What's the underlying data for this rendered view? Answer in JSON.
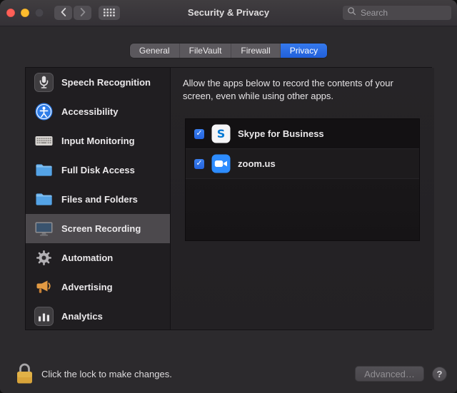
{
  "window": {
    "title": "Security & Privacy"
  },
  "toolbar": {
    "search_placeholder": "Search"
  },
  "tabs": {
    "items": [
      {
        "label": "General",
        "active": false
      },
      {
        "label": "FileVault",
        "active": false
      },
      {
        "label": "Firewall",
        "active": false
      },
      {
        "label": "Privacy",
        "active": true
      }
    ]
  },
  "sidebar": {
    "items": [
      {
        "label": "Speech Recognition",
        "icon": "microphone-icon",
        "selected": false
      },
      {
        "label": "Accessibility",
        "icon": "accessibility-icon",
        "selected": false
      },
      {
        "label": "Input Monitoring",
        "icon": "keyboard-icon",
        "selected": false
      },
      {
        "label": "Full Disk Access",
        "icon": "folder-icon",
        "selected": false
      },
      {
        "label": "Files and Folders",
        "icon": "folder-icon",
        "selected": false
      },
      {
        "label": "Screen Recording",
        "icon": "display-icon",
        "selected": true
      },
      {
        "label": "Automation",
        "icon": "gear-icon",
        "selected": false
      },
      {
        "label": "Advertising",
        "icon": "megaphone-icon",
        "selected": false
      },
      {
        "label": "Analytics",
        "icon": "analytics-icon",
        "selected": false
      }
    ]
  },
  "panel": {
    "description": "Allow the apps below to record the contents of your screen, even while using other apps.",
    "apps": [
      {
        "name": "Skype for Business",
        "icon": "skype-icon",
        "checked": true
      },
      {
        "name": "zoom.us",
        "icon": "zoom-icon",
        "checked": true
      }
    ]
  },
  "footer": {
    "lock_message": "Click the lock to make changes.",
    "advanced_button": "Advanced…",
    "help_button": "?"
  },
  "colors": {
    "accent_blue": "#2а67e2",
    "selected_tab_blue": "#2a6be2",
    "checkbox_blue": "#2e6fe6",
    "traffic_red": "#ff5f57",
    "traffic_yellow": "#febc2e",
    "lock_gold": "#d9a43a"
  }
}
